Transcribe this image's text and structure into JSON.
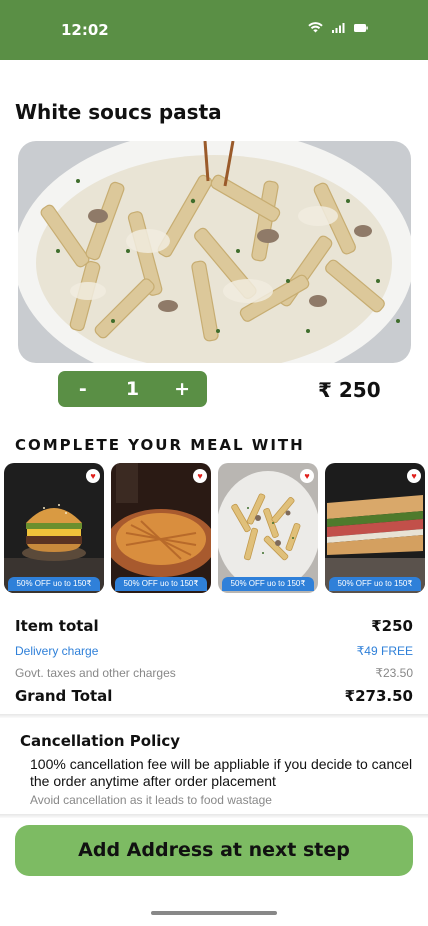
{
  "status_bar": {
    "time": "12:02",
    "color": "#5a8f45"
  },
  "product": {
    "title": "White soucs pasta",
    "quantity": "1",
    "decrement_label": "-",
    "increment_label": "+",
    "price": "₹ 250"
  },
  "complete_meal": {
    "heading": "COMPLETE YOUR MEAL WITH",
    "items": [
      {
        "image": "burger",
        "offer": "50% OFF uo to 150₹"
      },
      {
        "image": "pie",
        "offer": "50% OFF uo to 150₹"
      },
      {
        "image": "pasta",
        "offer": "50% OFF uo to 150₹"
      },
      {
        "image": "sandwich",
        "offer": "50% OFF uo to 150₹"
      }
    ]
  },
  "bill": {
    "item_total_label": "Item total",
    "item_total_value": "₹250",
    "delivery_label": "Delivery charge",
    "delivery_value": "₹49 FREE",
    "taxes_label": "Govt. taxes and other charges",
    "taxes_value": "₹23.50",
    "grand_total_label": "Grand Total",
    "grand_total_value": "₹273.50"
  },
  "cancellation": {
    "title": "Cancellation Policy",
    "text": "100% cancellation fee will be appliable if you decide to cancel the order anytime after order placement",
    "note": "Avoid cancellation as it leads to food wastage"
  },
  "cta_label": "Add Address at next step",
  "colors": {
    "brand": "#5a8f45",
    "cta": "#7dbb63",
    "offer": "#2f80d9"
  }
}
